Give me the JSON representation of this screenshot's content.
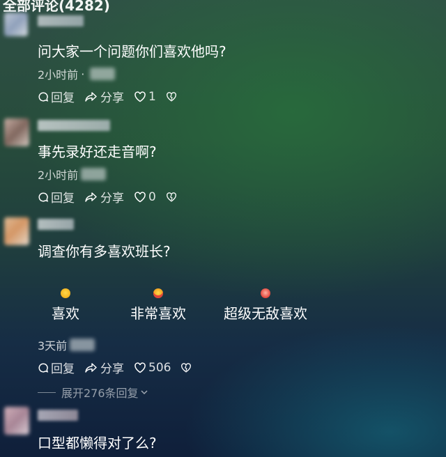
{
  "header": {
    "title": "全部评论(4282)"
  },
  "comments": [
    {
      "text": "问大家一个问题你们喜欢他吗?",
      "time": "2小时前",
      "separator": "·",
      "reply_label": "回复",
      "share_label": "分享",
      "like_count": "1"
    },
    {
      "text": "事先录好还走音啊?",
      "time": "2小时前",
      "reply_label": "回复",
      "share_label": "分享",
      "like_count": "0"
    },
    {
      "text": "调查你有多喜欢班长?",
      "time": "3天前",
      "reply_label": "回复",
      "share_label": "分享",
      "like_count": "506",
      "poll": {
        "options": [
          {
            "label": "喜欢",
            "emoji": "laughing-emoji"
          },
          {
            "label": "非常喜欢",
            "emoji": "starstruck-emoji"
          },
          {
            "label": "超级无敌喜欢",
            "emoji": "heart-eyes-emoji"
          }
        ]
      },
      "expand_label": "展开276条回复"
    },
    {
      "text": "口型都懒得对了么?"
    }
  ],
  "colors": {
    "text_primary": "#ffffff",
    "text_secondary": "#c7d2cc",
    "emoji_yellow": "#f2c230",
    "emoji_red": "#e0443a"
  }
}
